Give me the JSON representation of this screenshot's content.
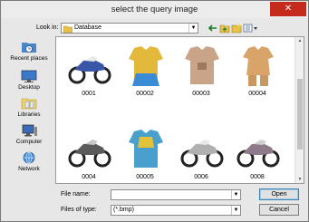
{
  "window": {
    "title": "select the query image",
    "close_glyph": "✕"
  },
  "lookin": {
    "label": "Look in:",
    "value": "Database"
  },
  "toolbar": [
    "back-icon",
    "up-folder-icon",
    "new-folder-icon",
    "view-menu-icon"
  ],
  "places": [
    {
      "label": "Recent places",
      "icon": "recent-places-icon"
    },
    {
      "label": "Desktop",
      "icon": "desktop-icon"
    },
    {
      "label": "Libraries",
      "icon": "libraries-icon"
    },
    {
      "label": "Computer",
      "icon": "computer-icon"
    },
    {
      "label": "Network",
      "icon": "network-icon"
    }
  ],
  "files": [
    {
      "name": "0001",
      "kind": "motorcycle",
      "color": "#3a56a8"
    },
    {
      "name": "00002",
      "kind": "garment",
      "color": "#e2b93a"
    },
    {
      "name": "00003",
      "kind": "garment",
      "color": "#c9a489"
    },
    {
      "name": "00004",
      "kind": "garment",
      "color": "#d9a46a"
    },
    {
      "name": "0004",
      "kind": "motorcycle",
      "color": "#5a5a5a"
    },
    {
      "name": "00005",
      "kind": "garment",
      "color": "#4aa0cc"
    },
    {
      "name": "0006",
      "kind": "motorcycle",
      "color": "#9a9a9a"
    },
    {
      "name": "0008",
      "kind": "motorcycle",
      "color": "#8e7a8a"
    }
  ],
  "filename": {
    "label": "File name:",
    "value": ""
  },
  "filetype": {
    "label": "Files of type:",
    "value": "(*.bmp)"
  },
  "buttons": {
    "open": "Open",
    "cancel": "Cancel"
  }
}
